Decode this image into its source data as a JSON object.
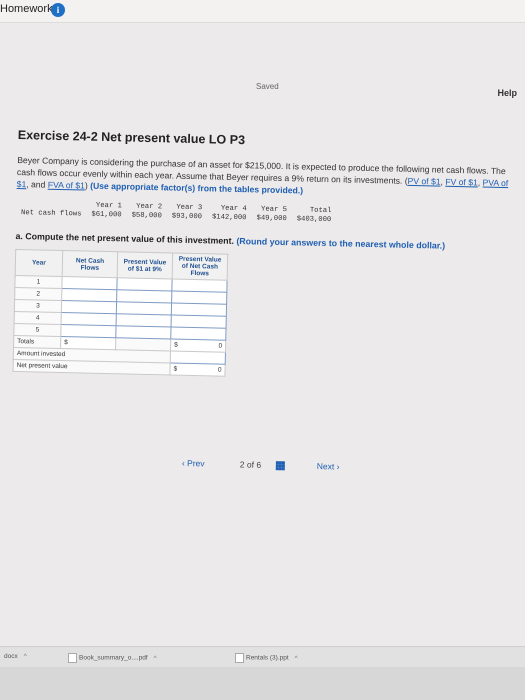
{
  "header": {
    "title": "Homework",
    "info_icon": "i",
    "saved": "Saved",
    "help": "Help"
  },
  "exercise": {
    "title": "Exercise 24-2 Net present value LO P3",
    "paragraph": {
      "lead": "Beyer Company is considering the purchase of an asset for $215,000. It is expected to produce the following net cash flows. The cash flows occur evenly within each year. Assume that Beyer requires a 9% return on its investments.",
      "links": [
        "PV of $1",
        "FV of $1",
        "PVA of $1",
        "FVA of $1"
      ],
      "link_sep": ",",
      "and": "and",
      "instruction": "(Use appropriate factor(s) from the tables provided.)"
    },
    "cash_flows": {
      "row_label": "Net cash flows",
      "years": [
        "Year 1",
        "Year 2",
        "Year 3",
        "Year 4",
        "Year 5",
        "Total"
      ],
      "values": [
        "$61,000",
        "$58,000",
        "$93,000",
        "$142,000",
        "$49,000",
        "$403,000"
      ]
    },
    "question": {
      "text": "a. Compute the net present value of this investment.",
      "instruction": "(Round your answers to the nearest whole dollar.)"
    },
    "npv_table": {
      "headers": [
        "Year",
        "Net Cash Flows",
        "Present Value of $1 at 9%",
        "Present Value of Net Cash Flows"
      ],
      "years": [
        "1",
        "2",
        "3",
        "4",
        "5"
      ],
      "totals_label": "Totals",
      "totals_dollar_1": "$",
      "totals_dollar_2": "$",
      "totals_value": "0",
      "amount_invested_label": "Amount invested",
      "npv_label": "Net present value",
      "npv_dollar": "$",
      "npv_value": "0"
    }
  },
  "pager": {
    "prev": "Prev",
    "position": "2 of 6",
    "next": "Next"
  },
  "downloads": [
    "docx",
    "Book_summary_o....pdf",
    "Rentals (3).ppt"
  ]
}
